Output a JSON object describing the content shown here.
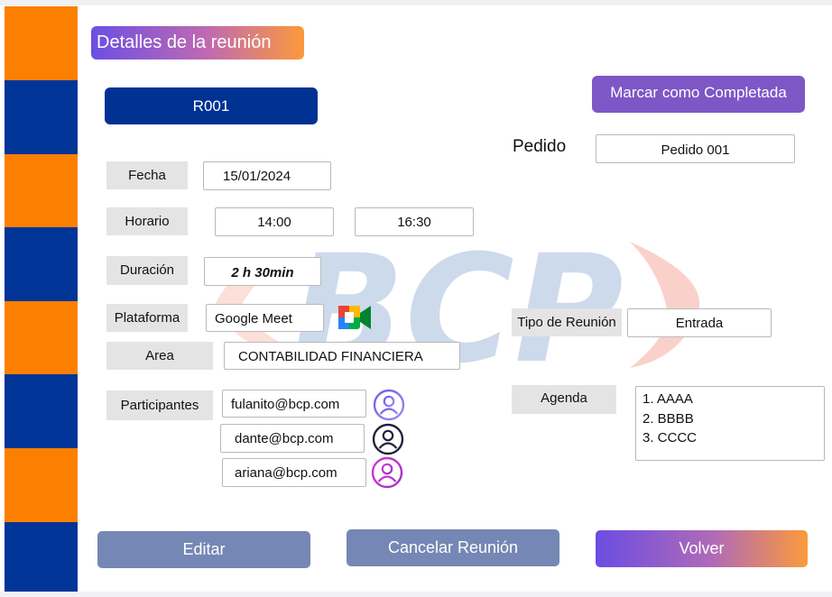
{
  "header": {
    "title": "Detalles de la reunión"
  },
  "meeting": {
    "code": "R001",
    "mark_complete_label": "Marcar como Completada",
    "pedido_label": "Pedido",
    "pedido_value": "Pedido 001",
    "fecha_label": "Fecha",
    "fecha_value": "15/01/2024",
    "horario_label": "Horario",
    "horario_start": "14:00",
    "horario_end": "16:30",
    "duracion_label": "Duración",
    "duracion_value": "2 h 30min",
    "plataforma_label": "Plataforma",
    "plataforma_value": "Google Meet",
    "area_label": "Area",
    "area_value": "CONTABILIDAD FINANCIERA",
    "tipo_label": "Tipo de Reunión",
    "tipo_value": "Entrada",
    "participantes_label": "Participantes",
    "participants": [
      "fulanito@bcp.com",
      "dante@bcp.com",
      "ariana@bcp.com"
    ],
    "agenda_label": "Agenda",
    "agenda_items": [
      "1. AAAA",
      "2. BBBB",
      "3. CCCC"
    ]
  },
  "actions": {
    "edit_label": "Editar",
    "cancel_label": "Cancelar Reunión",
    "back_label": "Volver"
  },
  "watermark": {
    "text": "BCP"
  },
  "colors": {
    "sidebar_orange": "#fd7f00",
    "sidebar_blue": "#003497",
    "primary_blue": "#003294",
    "complete_purple": "#7e57c6",
    "secondary_button": "#7587b4",
    "label_gray": "#e4e4e4"
  },
  "icons": {
    "platform": "google-meet-icon",
    "participant": "user-circle-icon"
  }
}
